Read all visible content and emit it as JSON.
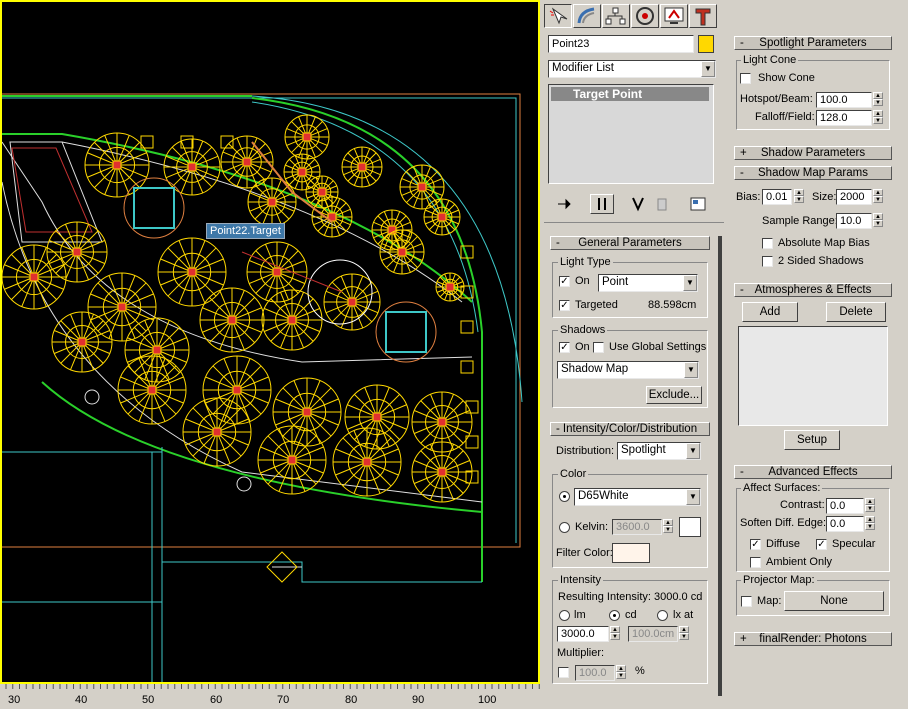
{
  "viewport": {
    "tooltip": "Point22.Target",
    "ruler_ticks": [
      "30",
      "40",
      "50",
      "60",
      "70",
      "80",
      "90",
      "100"
    ]
  },
  "command_panel": {
    "tab_icons": [
      "create-icon",
      "modify-icon",
      "hierarchy-icon",
      "motion-icon",
      "display-icon",
      "utilities-icon"
    ],
    "object_name": "Point23",
    "object_color": "#ffd800",
    "modifier_list": "Modifier List",
    "stack_item": "Target Point",
    "stack_icons": [
      "pin-stack-icon",
      "show-end-result-icon",
      "make-unique-icon",
      "remove-modifier-icon",
      "configure-sets-icon"
    ]
  },
  "general": {
    "title": "General Parameters",
    "light_type_group": "Light Type",
    "on_label": "On",
    "on_checked": "✓",
    "type_value": "Point",
    "targeted_label": "Targeted",
    "targeted_checked": "✓",
    "targeted_distance": "88.598cm",
    "shadows_group": "Shadows",
    "shadows_on_label": "On",
    "shadows_on_checked": "✓",
    "use_global_label": "Use Global Settings",
    "shadow_type": "Shadow Map",
    "exclude_button": "Exclude..."
  },
  "intensity": {
    "title": "Intensity/Color/Distribution",
    "distribution_label": "Distribution:",
    "distribution_value": "Spotlight",
    "color_group": "Color",
    "color_preset": "D65White",
    "kelvin_label": "Kelvin:",
    "kelvin_value": "3600.0",
    "kelvin_swatch": "#ffffff",
    "filter_color_label": "Filter Color:",
    "filter_color_swatch": "#fff4ea",
    "intensity_group": "Intensity",
    "resulting_intensity": "Resulting Intensity:  3000.0 cd",
    "lm_label": "lm",
    "cd_label": "cd",
    "lxat_label": "lx at",
    "intensity_value": "3000.0",
    "distance_value": "100.0cm",
    "multiplier_label": "Multiplier:",
    "multiplier_value": "100.0",
    "percent_label": "%"
  },
  "spotlight": {
    "title": "Spotlight Parameters",
    "cone_group": "Light Cone",
    "show_cone_label": "Show Cone",
    "hotspot_label": "Hotspot/Beam:",
    "hotspot_value": "100.0",
    "falloff_label": "Falloff/Field:",
    "falloff_value": "128.0"
  },
  "shadow_params": {
    "title": "Shadow Parameters"
  },
  "shadow_map": {
    "title": "Shadow Map Params",
    "bias_label": "Bias:",
    "bias_value": "0.01",
    "size_label": "Size:",
    "size_value": "2000",
    "sample_range_label": "Sample Range:",
    "sample_range_value": "10.0",
    "absolute_bias_label": "Absolute Map Bias",
    "two_sided_label": "2 Sided Shadows"
  },
  "atmospheres": {
    "title": "Atmospheres & Effects",
    "add_button": "Add",
    "delete_button": "Delete",
    "setup_button": "Setup"
  },
  "advanced": {
    "title": "Advanced Effects",
    "affect_group": "Affect Surfaces:",
    "contrast_label": "Contrast:",
    "contrast_value": "0.0",
    "soften_label": "Soften Diff. Edge:",
    "soften_value": "0.0",
    "diffuse_label": "Diffuse",
    "diffuse_checked": "✓",
    "specular_label": "Specular",
    "specular_checked": "✓",
    "ambient_label": "Ambient Only",
    "projector_group": "Projector Map:",
    "map_label": "Map:",
    "map_button": "None"
  },
  "final_render": {
    "title": "finalRender: Photons"
  },
  "signs": {
    "minus": "-",
    "plus": "+"
  }
}
